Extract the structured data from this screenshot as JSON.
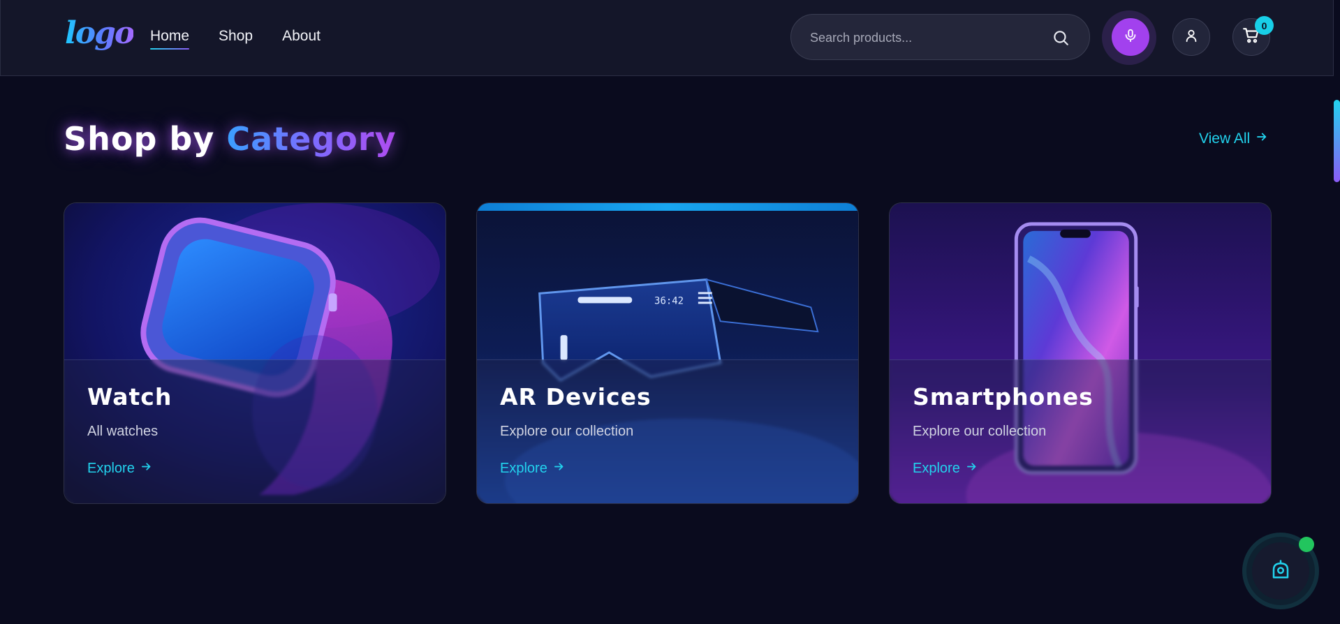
{
  "header": {
    "logo_text": "logo",
    "nav": [
      {
        "label": "Home",
        "active": true
      },
      {
        "label": "Shop",
        "active": false
      },
      {
        "label": "About",
        "active": false
      }
    ],
    "search": {
      "placeholder": "Search products...",
      "value": ""
    },
    "cart_count": "0",
    "icons": {
      "search": "search-icon",
      "mic": "microphone-icon",
      "user": "user-icon",
      "cart": "cart-icon",
      "arrow": "arrow-right-icon",
      "assistant": "assistant-icon"
    }
  },
  "section": {
    "title_main": "Shop by",
    "title_accent": "Category",
    "view_all": "View All"
  },
  "categories": [
    {
      "title": "Watch",
      "subtitle": "All watches",
      "link": "Explore"
    },
    {
      "title": "AR Devices",
      "subtitle": "Explore our collection",
      "link": "Explore"
    },
    {
      "title": "Smartphones",
      "subtitle": "Explore our collection",
      "link": "Explore"
    }
  ],
  "theme": {
    "background": "#0a0b1e",
    "accent_cyan": "#22d3ee",
    "accent_purple": "#a241ee",
    "status_online": "#22c55e"
  }
}
